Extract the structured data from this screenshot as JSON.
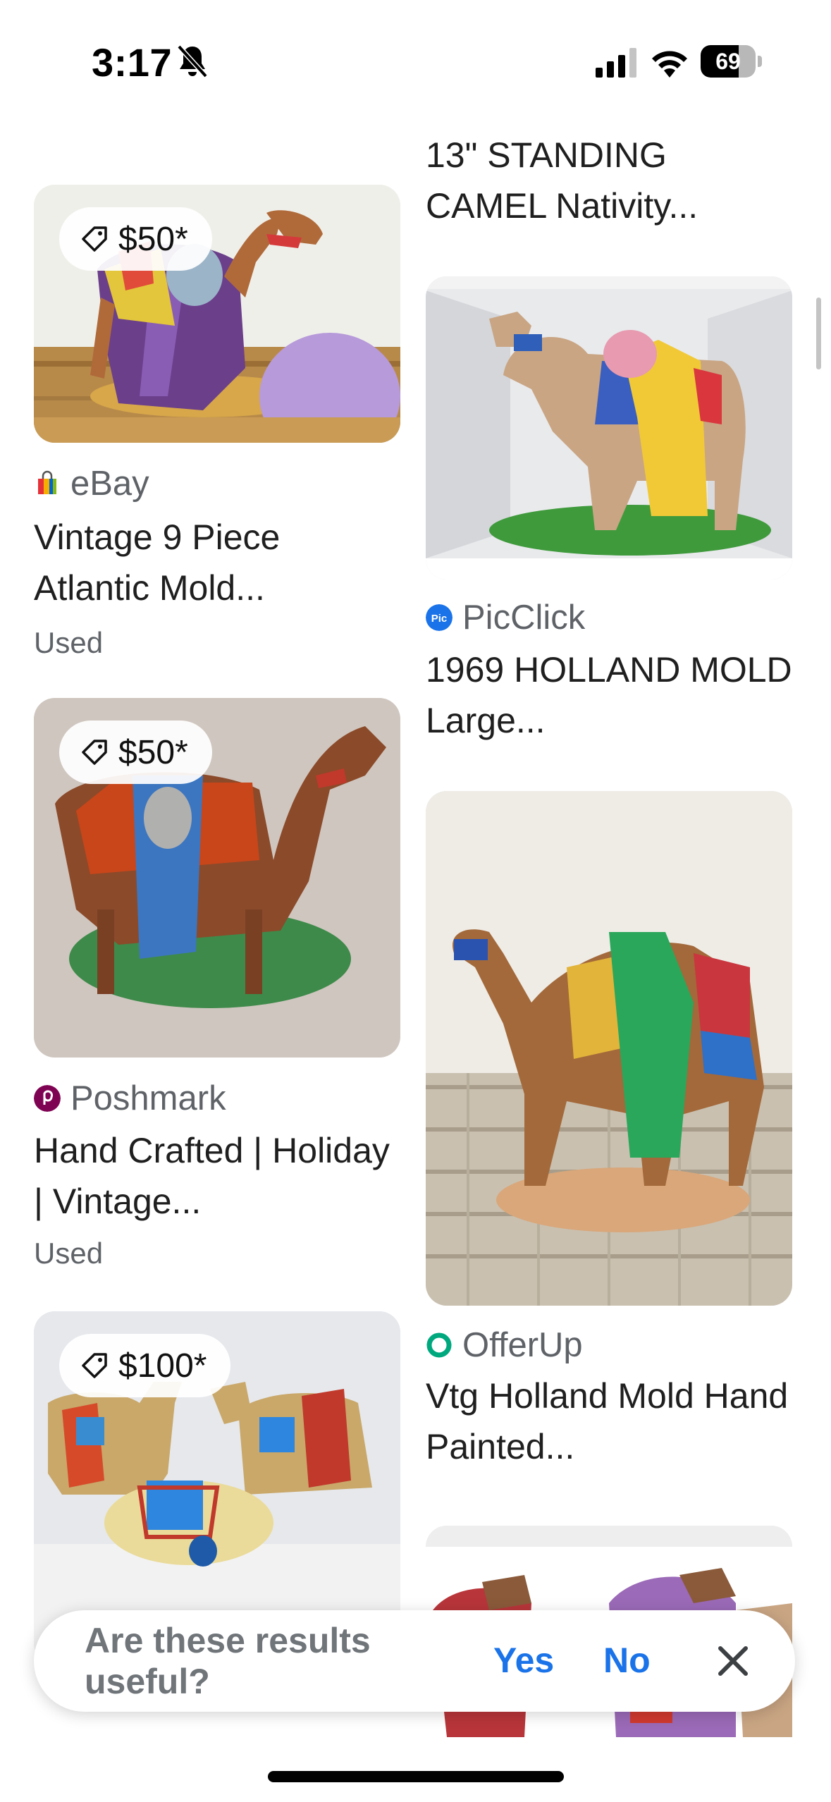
{
  "status_bar": {
    "time": "3:17",
    "battery_percent": "69",
    "battery_level": 0.69,
    "icons": [
      "bell-off-icon",
      "cell-signal-icon",
      "wifi-icon",
      "battery-icon"
    ]
  },
  "results": {
    "left_column": [
      {
        "price": "$50*",
        "source": "eBay",
        "source_icon": "ebay-bag-icon",
        "title": "Vintage 9 Piece Atlantic Mold...",
        "condition": "Used"
      },
      {
        "price": "$50*",
        "source": "Poshmark",
        "source_icon": "poshmark-icon",
        "source_color": "#7f0353",
        "title": "Hand Crafted | Holiday | Vintage...",
        "condition": "Used"
      },
      {
        "price": "$100*",
        "source": "",
        "title": ""
      }
    ],
    "right_column": [
      {
        "title": "13\" STANDING CAMEL Nativity..."
      },
      {
        "source": "PicClick",
        "source_icon": "picclick-icon",
        "source_color": "#1a73e8",
        "title": "1969 HOLLAND MOLD Large..."
      },
      {
        "source": "OfferUp",
        "source_icon": "offerup-icon",
        "source_color": "#00a87e",
        "title": "Vtg Holland Mold Hand Painted..."
      },
      {
        "title": ""
      }
    ]
  },
  "feedback": {
    "question": "Are these results useful?",
    "yes_label": "Yes",
    "no_label": "No",
    "accent": "#1a73e8"
  }
}
